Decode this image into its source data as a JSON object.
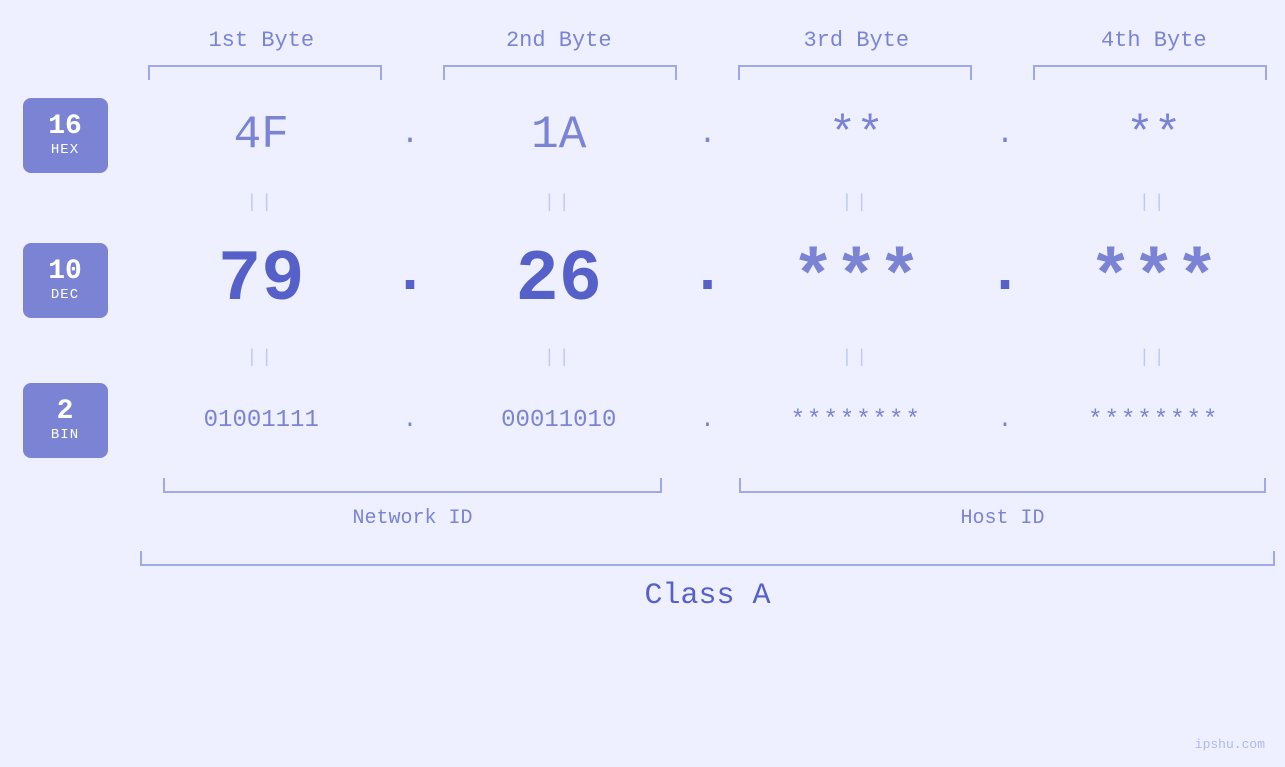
{
  "header": {
    "bytes": [
      "1st Byte",
      "2nd Byte",
      "3rd Byte",
      "4th Byte"
    ]
  },
  "bases": [
    {
      "number": "16",
      "label": "HEX"
    },
    {
      "number": "10",
      "label": "DEC"
    },
    {
      "number": "2",
      "label": "BIN"
    }
  ],
  "hex_row": {
    "values": [
      "4F",
      "1A",
      "**",
      "**"
    ],
    "dots": [
      ".",
      ".",
      ".",
      ""
    ]
  },
  "dec_row": {
    "values": [
      "79",
      "26",
      "***",
      "***"
    ],
    "dots": [
      ".",
      ".",
      ".",
      ""
    ]
  },
  "bin_row": {
    "values": [
      "01001111",
      "00011010",
      "********",
      "********"
    ],
    "dots": [
      ".",
      ".",
      ".",
      ""
    ]
  },
  "bottom": {
    "network_id": "Network ID",
    "host_id": "Host ID",
    "class": "Class A"
  },
  "watermark": "ipshu.com"
}
